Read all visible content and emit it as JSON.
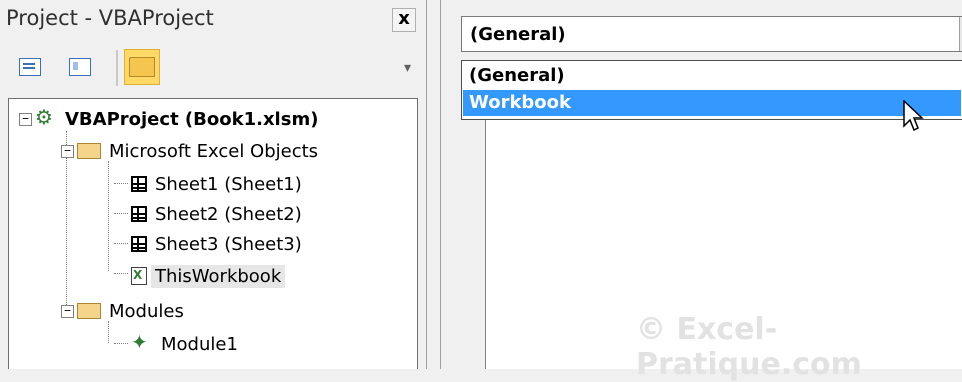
{
  "project_pane": {
    "title": "Project - VBAProject",
    "close_label": "x",
    "toolbar": {
      "view_code_icon": "view-code-icon",
      "view_object_icon": "view-object-icon",
      "toggle_folders_icon": "toggle-folders-icon"
    },
    "tree": {
      "project": "VBAProject (Book1.xlsm)",
      "excel_objects_folder": "Microsoft Excel Objects",
      "sheets": [
        "Sheet1 (Sheet1)",
        "Sheet2 (Sheet2)",
        "Sheet3 (Sheet3)"
      ],
      "workbook": "ThisWorkbook",
      "modules_folder": "Modules",
      "module": "Module1"
    }
  },
  "code_pane": {
    "object_dropdown": {
      "value": "(General)",
      "options": [
        "(General)",
        "Workbook"
      ],
      "highlighted": "Workbook"
    },
    "watermark": "© Excel-Pratique.com"
  }
}
